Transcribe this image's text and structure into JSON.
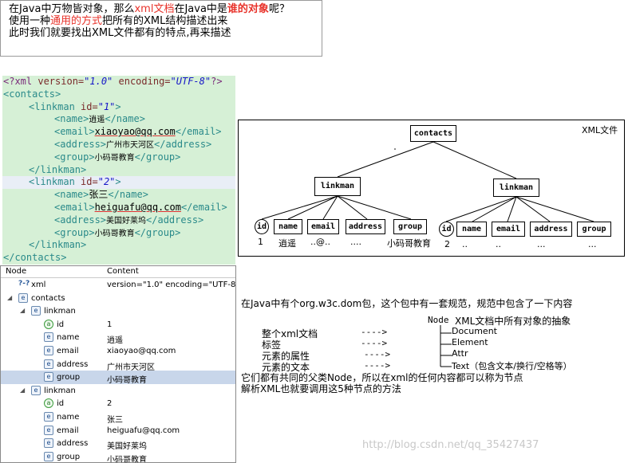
{
  "intro": {
    "line1": [
      {
        "text": "在Java中万物皆对象，那么",
        "style": ""
      },
      {
        "text": "xml文档",
        "style": "red"
      },
      {
        "text": "在Java中是",
        "style": ""
      },
      {
        "text": "谁的对象",
        "style": "redb"
      },
      {
        "text": "呢？",
        "style": ""
      }
    ],
    "line2": [
      {
        "text": "使用一种",
        "style": ""
      },
      {
        "text": "通用的方式",
        "style": "red"
      },
      {
        "text": "把所有的XML结构描述出来",
        "style": ""
      }
    ],
    "line3": [
      {
        "text": "此时我们就要找出XML文件都有的特点,再来描述",
        "style": ""
      }
    ]
  },
  "code_lines": [
    {
      "indent": 0,
      "hl": false,
      "parts": [
        {
          "c": "pi",
          "t": "<?xml "
        },
        {
          "c": "at",
          "t": "version="
        },
        {
          "c": "av",
          "t": "\"1.0\""
        },
        {
          "c": "at",
          "t": " encoding="
        },
        {
          "c": "av",
          "t": "\"UTF-8\""
        },
        {
          "c": "pi",
          "t": "?>"
        }
      ]
    },
    {
      "indent": 0,
      "hl": false,
      "parts": [
        {
          "c": "tg",
          "t": "<contacts>"
        }
      ]
    },
    {
      "indent": 1,
      "hl": false,
      "parts": [
        {
          "c": "tg",
          "t": "<linkman "
        },
        {
          "c": "at",
          "t": "id="
        },
        {
          "c": "av",
          "t": "\"1\""
        },
        {
          "c": "tg",
          "t": ">"
        }
      ]
    },
    {
      "indent": 2,
      "hl": false,
      "parts": [
        {
          "c": "tg",
          "t": "<name>"
        },
        {
          "c": "cn",
          "t": "逍遥"
        },
        {
          "c": "tg",
          "t": "</name>"
        }
      ]
    },
    {
      "indent": 2,
      "hl": false,
      "parts": [
        {
          "c": "tg",
          "t": "<email>"
        },
        {
          "c": "ul",
          "t": "xiaoyao@qq.com"
        },
        {
          "c": "tg",
          "t": "</email>"
        }
      ]
    },
    {
      "indent": 2,
      "hl": false,
      "parts": [
        {
          "c": "tg",
          "t": "<address>"
        },
        {
          "c": "cn",
          "t": "广州市天河区"
        },
        {
          "c": "tg",
          "t": "</address>"
        }
      ]
    },
    {
      "indent": 2,
      "hl": false,
      "parts": [
        {
          "c": "tg",
          "t": "<group>"
        },
        {
          "c": "cn",
          "t": "小码哥教育"
        },
        {
          "c": "tg",
          "t": "</group>"
        }
      ]
    },
    {
      "indent": 1,
      "hl": false,
      "parts": [
        {
          "c": "tg",
          "t": "</linkman>"
        }
      ]
    },
    {
      "indent": 1,
      "hl": true,
      "parts": [
        {
          "c": "tg",
          "t": "<linkman "
        },
        {
          "c": "at",
          "t": "id="
        },
        {
          "c": "av",
          "t": "\"2\""
        },
        {
          "c": "tg",
          "t": ">"
        }
      ]
    },
    {
      "indent": 2,
      "hl": false,
      "parts": [
        {
          "c": "tg",
          "t": "<name>"
        },
        {
          "c": "tx",
          "t": "张三"
        },
        {
          "c": "tg",
          "t": "</name>"
        }
      ]
    },
    {
      "indent": 2,
      "hl": false,
      "parts": [
        {
          "c": "tg",
          "t": "<email>"
        },
        {
          "c": "ul",
          "t": "heiguafu@qq.com"
        },
        {
          "c": "tg",
          "t": "</email>"
        }
      ]
    },
    {
      "indent": 2,
      "hl": false,
      "parts": [
        {
          "c": "tg",
          "t": "<address>"
        },
        {
          "c": "cn",
          "t": "美国好莱坞"
        },
        {
          "c": "tg",
          "t": "</address>"
        }
      ]
    },
    {
      "indent": 2,
      "hl": false,
      "parts": [
        {
          "c": "tg",
          "t": "<group>"
        },
        {
          "c": "cn",
          "t": "小码哥教育"
        },
        {
          "c": "tg",
          "t": "</group>"
        }
      ]
    },
    {
      "indent": 1,
      "hl": false,
      "parts": [
        {
          "c": "tg",
          "t": "</linkman>"
        }
      ]
    },
    {
      "indent": 0,
      "hl": false,
      "parts": [
        {
          "c": "tg",
          "t": "</contacts>"
        }
      ]
    }
  ],
  "tree": {
    "col_node": "Node",
    "col_content": "Content",
    "rows": [
      {
        "level": 0,
        "twisty": "",
        "icon": "?-?",
        "type": "pi",
        "node": "xml",
        "content": "version=\"1.0\" encoding=\"UTF-8\"",
        "sel": false
      },
      {
        "level": 0,
        "twisty": "◢",
        "icon": "e",
        "type": "el",
        "node": "contacts",
        "content": "",
        "sel": false
      },
      {
        "level": 1,
        "twisty": "◢",
        "icon": "e",
        "type": "el",
        "node": "linkman",
        "content": "",
        "sel": false
      },
      {
        "level": 2,
        "twisty": "",
        "icon": "a",
        "type": "att",
        "node": "id",
        "content": "1",
        "sel": false
      },
      {
        "level": 2,
        "twisty": "",
        "icon": "e",
        "type": "el",
        "node": "name",
        "content": "逍遥",
        "sel": false
      },
      {
        "level": 2,
        "twisty": "",
        "icon": "e",
        "type": "el",
        "node": "email",
        "content": "xiaoyao@qq.com",
        "sel": false
      },
      {
        "level": 2,
        "twisty": "",
        "icon": "e",
        "type": "el",
        "node": "address",
        "content": "广州市天河区",
        "sel": false
      },
      {
        "level": 2,
        "twisty": "",
        "icon": "e",
        "type": "el",
        "node": "group",
        "content": "小码哥教育",
        "sel": true
      },
      {
        "level": 1,
        "twisty": "◢",
        "icon": "e",
        "type": "el",
        "node": "linkman",
        "content": "",
        "sel": false
      },
      {
        "level": 2,
        "twisty": "",
        "icon": "a",
        "type": "att",
        "node": "id",
        "content": "2",
        "sel": false
      },
      {
        "level": 2,
        "twisty": "",
        "icon": "e",
        "type": "el",
        "node": "name",
        "content": "张三",
        "sel": false
      },
      {
        "level": 2,
        "twisty": "",
        "icon": "e",
        "type": "el",
        "node": "email",
        "content": "heiguafu@qq.com",
        "sel": false
      },
      {
        "level": 2,
        "twisty": "",
        "icon": "e",
        "type": "el",
        "node": "address",
        "content": "美国好莱坞",
        "sel": false
      },
      {
        "level": 2,
        "twisty": "",
        "icon": "e",
        "type": "el",
        "node": "group",
        "content": "小码哥教育",
        "sel": false
      }
    ]
  },
  "diagram": {
    "caption": "XML文件",
    "root": "contacts",
    "linkman": "linkman",
    "left_children": [
      "id",
      "name",
      "email",
      "address",
      "group"
    ],
    "right_children": [
      "id",
      "name",
      "email",
      "address",
      "group"
    ],
    "left_values": [
      "1",
      "逍遥",
      "..@..",
      "....",
      "小码哥教育"
    ],
    "right_values": [
      "2",
      "..",
      "..",
      "...",
      "..."
    ]
  },
  "explain": {
    "intro": "在Java中有个org.w3c.dom包，这个包中有一套规范，规范中包含了一下内容",
    "node_label": "Node",
    "node_desc": "XML文档中所有对象的抽象",
    "items": [
      {
        "left": "整个xml文档",
        "arrow": "---->",
        "right": "Document"
      },
      {
        "left": "标签",
        "arrow": "---->",
        "right": "Element"
      },
      {
        "left": "元素的属性",
        "arrow": "---->",
        "right": "Attr"
      },
      {
        "left": "元素的文本",
        "arrow": "---->",
        "right": "Text（包含文本/换行/空格等）"
      }
    ],
    "summary1": "它们都有共同的父类Node，所以在xml的任何内容都可以称为节点",
    "summary2": "解析XML也就要调用这5种节点的方法"
  },
  "watermark": "http://blog.csdn.net/qq_35427437"
}
